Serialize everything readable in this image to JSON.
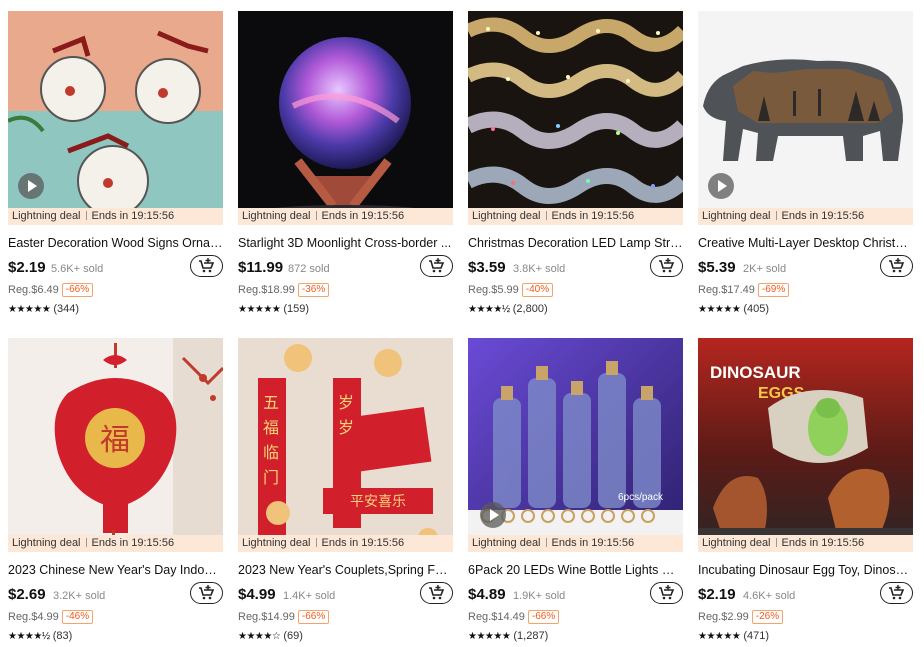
{
  "deal_label": "Lightning deal",
  "ends_label": "Ends in 19:15:56",
  "products": [
    {
      "title": "Easter Decoration Wood Signs Ornam...",
      "price": "$2.19",
      "sold": "5.6K+ sold",
      "reg": "Reg.$6.49",
      "discount": "-66%",
      "stars": "★★★★★",
      "reviews": "(344)"
    },
    {
      "title": "Starlight 3D Moonlight Cross-border ...",
      "price": "$11.99",
      "sold": "872 sold",
      "reg": "Reg.$18.99",
      "discount": "-36%",
      "stars": "★★★★★",
      "reviews": "(159)"
    },
    {
      "title": "Christmas Decoration LED Lamp Strip...",
      "price": "$3.59",
      "sold": "3.8K+ sold",
      "reg": "Reg.$5.99",
      "discount": "-40%",
      "stars": "★★★★½",
      "reviews": "(2,800)"
    },
    {
      "title": "Creative Multi-Layer Desktop Christm...",
      "price": "$5.39",
      "sold": "2K+ sold",
      "reg": "Reg.$17.49",
      "discount": "-69%",
      "stars": "★★★★★",
      "reviews": "(405)"
    },
    {
      "title": "2023 Chinese New Year's Day Indoor ...",
      "price": "$2.69",
      "sold": "3.2K+ sold",
      "reg": "Reg.$4.99",
      "discount": "-46%",
      "stars": "★★★★½",
      "reviews": "(83)"
    },
    {
      "title": "2023 New Year's Couplets,Spring Fes...",
      "price": "$4.99",
      "sold": "1.4K+ sold",
      "reg": "Reg.$14.99",
      "discount": "-66%",
      "stars": "★★★★☆",
      "reviews": "(69)"
    },
    {
      "title": "6Pack 20 LEDs Wine Bottle Lights Wit...",
      "price": "$4.89",
      "sold": "1.9K+ sold",
      "reg": "Reg.$14.49",
      "discount": "-66%",
      "stars": "★★★★★",
      "reviews": "(1,287)"
    },
    {
      "title": "Incubating Dinosaur Egg Toy, Dinosau...",
      "price": "$2.19",
      "sold": "4.6K+ sold",
      "reg": "Reg.$2.99",
      "discount": "-26%",
      "stars": "★★★★★",
      "reviews": "(471)"
    }
  ],
  "image_text": {
    "pack": "6pcs/pack",
    "dino_title": "DINOSAUR",
    "dino_sub": "EGGS",
    "banner": "平安喜乐"
  },
  "colors": {
    "deal_bg": "#fde7d6",
    "discount": "#f05a1a"
  }
}
